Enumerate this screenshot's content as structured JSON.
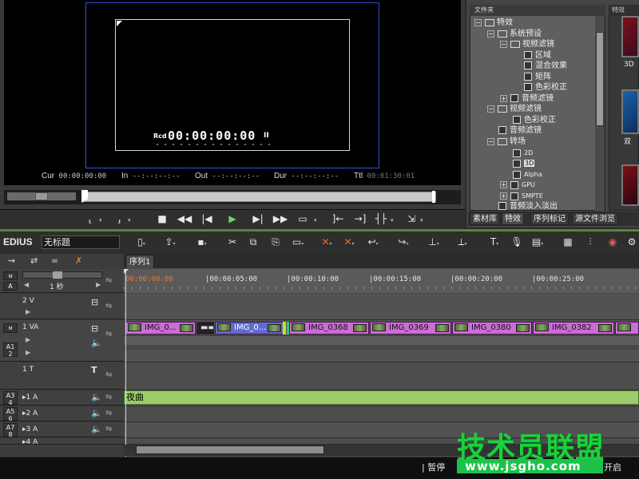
{
  "preview": {
    "rec_label": "Rcd",
    "rec_timecode": "00:00:00:00",
    "rec_pause": "II",
    "cur_label": "Cur",
    "cur_value": "00:00:00:00",
    "in_label": "In",
    "in_value": "--:--:--:--",
    "out_label": "Out",
    "out_value": "--:--:--:--",
    "dur_label": "Dur",
    "dur_value": "--:--:--:--",
    "ttl_label": "Ttl",
    "ttl_value": "00:01:30:01"
  },
  "transport": {
    "buttons": [
      "set-in",
      "set-out",
      "stop",
      "rewind",
      "step-back",
      "play",
      "step-forward",
      "fast-forward",
      "loop",
      "insert",
      "overwrite",
      "split",
      "export"
    ]
  },
  "folder_tree": {
    "header": "文件夹",
    "nodes": [
      {
        "label": "特效",
        "exp": "−"
      },
      {
        "label": "系统预设",
        "exp": "−"
      },
      {
        "label": "视频滤镜",
        "exp": "−"
      },
      {
        "label": "区域",
        "exp": ""
      },
      {
        "label": "混合效果",
        "exp": ""
      },
      {
        "label": "矩阵",
        "exp": ""
      },
      {
        "label": "色彩校正",
        "exp": ""
      },
      {
        "label": "音频滤镜",
        "exp": "+"
      },
      {
        "label": "视频滤镜",
        "exp": "−"
      },
      {
        "label": "色彩校正",
        "exp": ""
      },
      {
        "label": "音频滤镜",
        "exp": ""
      },
      {
        "label": "转场",
        "exp": "−"
      },
      {
        "label": "2D",
        "exp": ""
      },
      {
        "label": "3D",
        "exp": ""
      },
      {
        "label": "Alpha",
        "exp": ""
      },
      {
        "label": "GPU",
        "exp": "+"
      },
      {
        "label": "SMPTE",
        "exp": "+"
      },
      {
        "label": "音频淡入淡出",
        "exp": ""
      }
    ]
  },
  "effect_panel": {
    "header": "特效",
    "thumb1_label": "3D",
    "thumb2_label": "双"
  },
  "panel_tabs": [
    "素材库",
    "特效",
    "序列标记",
    "源文件浏览"
  ],
  "app": {
    "brand": "EDIUS",
    "project_name": "无标题"
  },
  "toolbar_icons": [
    "new-project",
    "open-project",
    "save",
    "cut",
    "copy",
    "paste",
    "replace",
    "delete",
    "ripple-delete",
    "undo",
    "redo",
    "add-marker",
    "title",
    "voice-over",
    "render",
    "layout",
    "mixer",
    "color-correction",
    "settings"
  ],
  "track_panel": {
    "scale_label": "1 秒",
    "tracks": [
      {
        "name": "2 V"
      },
      {
        "name": "1 VA"
      },
      {
        "name": "1 T"
      },
      {
        "name": "1 A"
      },
      {
        "name": "2 A"
      },
      {
        "name": "3 A"
      },
      {
        "name": "4 A"
      }
    ]
  },
  "timeline": {
    "sequence_tab": "序列1",
    "ruler": [
      "00:00:00:00",
      "00:00:05:00",
      "00:00:10:00",
      "00:00:15:00",
      "00:00:20:00",
      "00:00:25:00"
    ],
    "clips": [
      "IMG_0...",
      "IMG_0...",
      "IMG_0368",
      "IMG_0369",
      "IMG_0380",
      "IMG_0382"
    ],
    "music_clip": "夜曲"
  },
  "status": {
    "left": "暂停",
    "right": "开启"
  },
  "watermark": {
    "title": "技术员联盟",
    "url": "www.jsgho.com"
  }
}
